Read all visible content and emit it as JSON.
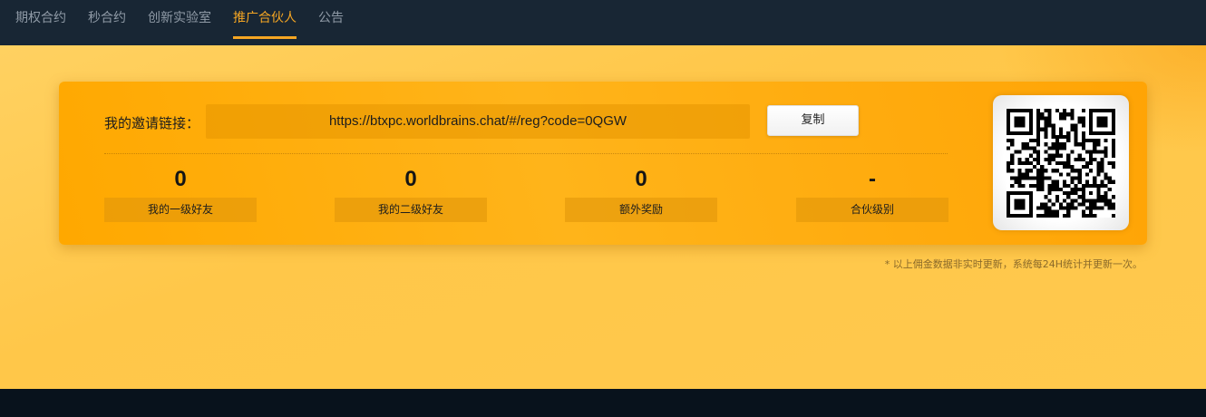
{
  "nav": {
    "items": [
      {
        "label": "期权合约"
      },
      {
        "label": "秒合约"
      },
      {
        "label": "创新实验室"
      },
      {
        "label": "推广合伙人"
      },
      {
        "label": "公告"
      }
    ],
    "active_index": 3
  },
  "invite": {
    "label": "我的邀请链接：",
    "link": "https://btxpc.worldbrains.chat/#/reg?code=0QGW",
    "copy_label": "复制"
  },
  "stats": [
    {
      "value": "0",
      "label": "我的一级好友"
    },
    {
      "value": "0",
      "label": "我的二级好友"
    },
    {
      "value": "0",
      "label": "额外奖励"
    },
    {
      "value": "-",
      "label": "合伙级别"
    }
  ],
  "note": "* 以上佣金数据非实时更新，系统每24H统计并更新一次。",
  "colors": {
    "nav_bg": "#182634",
    "accent": "#f5a623",
    "card": "#ffa800",
    "page_bg": "#ffc94d",
    "footer": "#08121c"
  }
}
